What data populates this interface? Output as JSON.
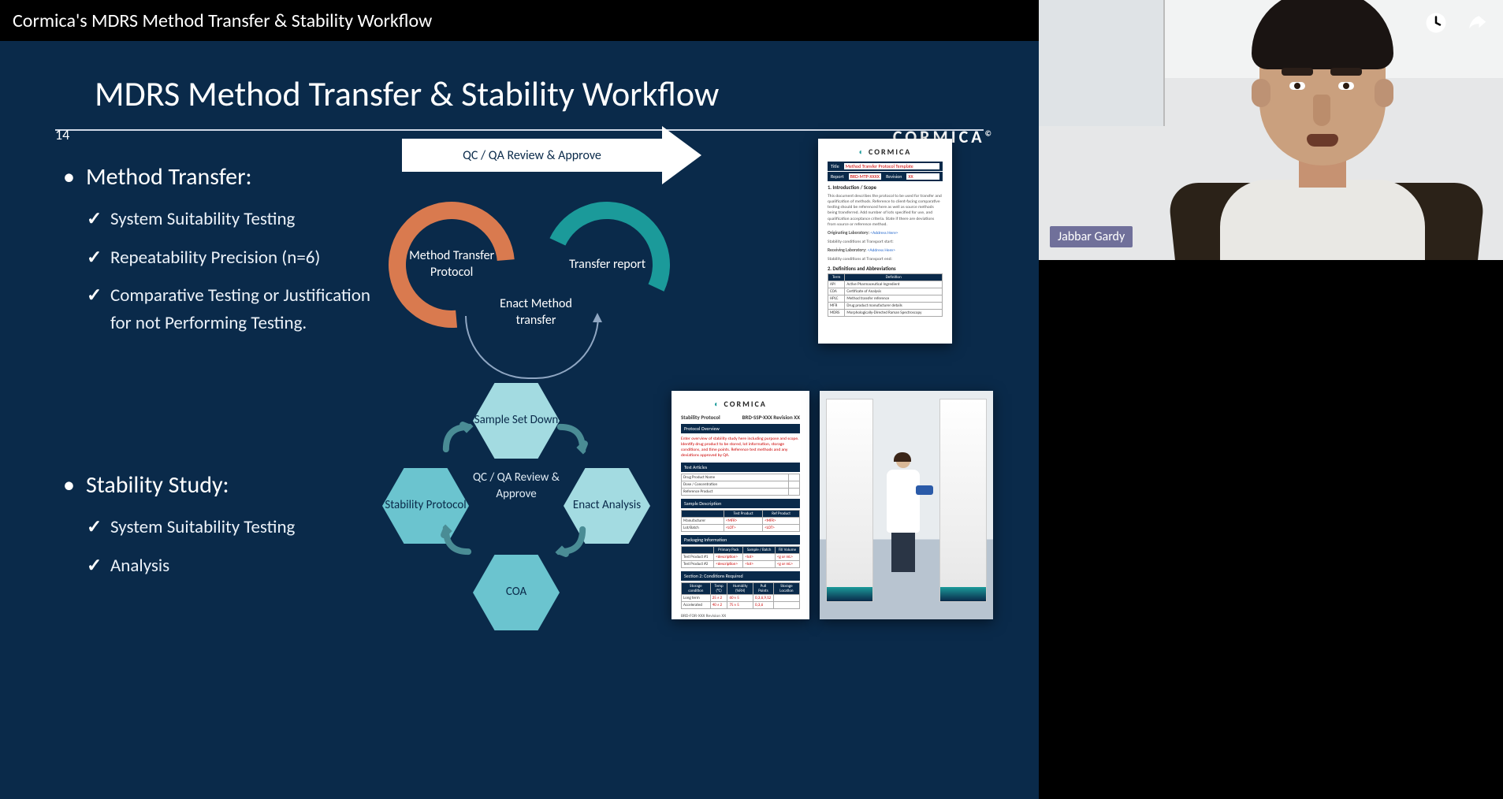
{
  "window_title": "Cormica's MDRS Method Transfer & Stability Workflow",
  "speaker": {
    "name": "Jabbar Gardy"
  },
  "slide": {
    "number": "14",
    "title": "MDRS Method Transfer & Stability Workflow",
    "brand": "CORMICA",
    "brand_mark": "©",
    "section1": {
      "title": "Method Transfer:",
      "items": [
        "System Suitability Testing",
        "Repeatability Precision (n=6)",
        "Comparative Testing or Justification for not Performing Testing."
      ]
    },
    "section2": {
      "title": "Stability Study:",
      "items": [
        "System Suitability Testing",
        "Analysis"
      ]
    },
    "arrow_label": "QC / QA Review & Approve",
    "rings": {
      "left": "Method Transfer Protocol",
      "right": "Transfer report",
      "middle": "Enact Method transfer"
    },
    "hex": {
      "top": "Sample Set Down",
      "right": "Enact Analysis",
      "bottom": "COA",
      "left": "Stability Protocol",
      "center": "QC / QA Review & Approve"
    },
    "doc1": {
      "logo": "CORMICA",
      "rows": [
        {
          "label": "Title",
          "value": "Method Transfer Protocol Template"
        },
        {
          "label": "Report",
          "value": "BRD-MTP-XXXX",
          "revision_label": "Revision",
          "revision": "XX"
        }
      ],
      "h1": "1. Introduction / Scope",
      "intro": "This document describes the protocol to be used for transfer and qualification of methods. Reference to client-facing comparative testing should be referenced here as well as source methods being transferred. Add number of lots specified for use, and qualification acceptance criteria. State if there are deviations from source or reference method.",
      "origin_label": "Originating Laboratory:",
      "origin_value": "<Address Here>",
      "stab_label": "Stability conditions at Transport start:",
      "recv_label": "Receiving Laboratory:",
      "recv_value": "<Address Here>",
      "stab2_label": "Stability conditions at Transport end:",
      "h2": "2. Definitions and Abbreviations",
      "table": [
        [
          "Term",
          "Definition"
        ],
        [
          "API",
          "Active Pharmaceutical Ingredient"
        ],
        [
          "COA",
          "Certificate of Analysis"
        ],
        [
          "HPLC",
          "Method transfer reference"
        ],
        [
          "MFR",
          "Drug product manufacturer details"
        ],
        [
          "MDRS",
          "Morphologically-Directed Raman Spectroscopy"
        ]
      ]
    },
    "doc2": {
      "logo": "CORMICA",
      "title_left": "Stability Protocol",
      "title_right": "BRD-SSP-XXX Revision XX",
      "h1": "Protocol Overview",
      "overview": "Enter overview of stability study here including purpose and scope. Identify drug product to be stored, lot information, storage conditions, and time points. Reference test methods and any deviations approved by QA.",
      "h2": "Test Articles",
      "test_rows": [
        [
          "Drug Product Name",
          ""
        ],
        [
          "Dose / Concentration",
          ""
        ],
        [
          "Reference Product",
          ""
        ]
      ],
      "h3": "Sample Description",
      "sample_head": [
        "",
        "Test Product",
        "Ref Product"
      ],
      "sample_rows": [
        [
          "Manufacturer",
          "<MFR>",
          "<MFR>"
        ],
        [
          "Lot/Batch",
          "<LOT>",
          "<LOT>"
        ]
      ],
      "h4": "Packaging Information",
      "pack_head": [
        "",
        "Primary Pack",
        "Sample / Batch",
        "Fill Volume"
      ],
      "pack_rows": [
        [
          "Test Product #1",
          "<description>",
          "<lot>",
          "<g or mL>"
        ],
        [
          "Test Product #2",
          "<description>",
          "<lot>",
          "<g or mL>"
        ]
      ],
      "h5": "Section 2: Conditions Required",
      "cond_head": [
        "Storage condition",
        "Temp (°C)",
        "Humidity (%RH)",
        "Pull Points",
        "Storage Location"
      ],
      "cond_rows": [
        [
          "Long term",
          "25 ± 2",
          "60 ± 5",
          "0,3,6,9,12",
          ""
        ],
        [
          "Accelerated",
          "40 ± 2",
          "75 ± 5",
          "0,3,6",
          ""
        ]
      ],
      "footer": "BRD-FOR-XXX Revision XX"
    }
  }
}
